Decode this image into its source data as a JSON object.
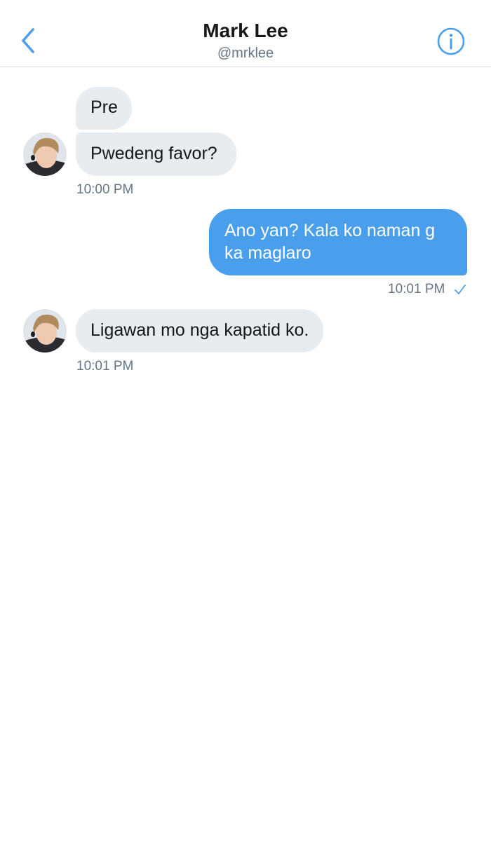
{
  "header": {
    "name": "Mark Lee",
    "handle": "@mrklee"
  },
  "messages": [
    {
      "sender": "them",
      "text": "Pre"
    },
    {
      "sender": "them",
      "text": "Pwedeng favor?",
      "time": "10:00 PM"
    },
    {
      "sender": "me",
      "text": "Ano yan? Kala ko naman g ka maglaro",
      "time": "10:01 PM",
      "status": "sent"
    },
    {
      "sender": "them",
      "text": "Ligawan mo nga kapatid ko.",
      "time": "10:01 PM"
    }
  ],
  "colors": {
    "accent": "#4a9fec",
    "incoming_bubble": "#e6ecf0",
    "text": "#14171a",
    "muted": "#657786"
  },
  "icons": {
    "back": "chevron-left-icon",
    "info": "info-icon",
    "status": "check-icon"
  }
}
